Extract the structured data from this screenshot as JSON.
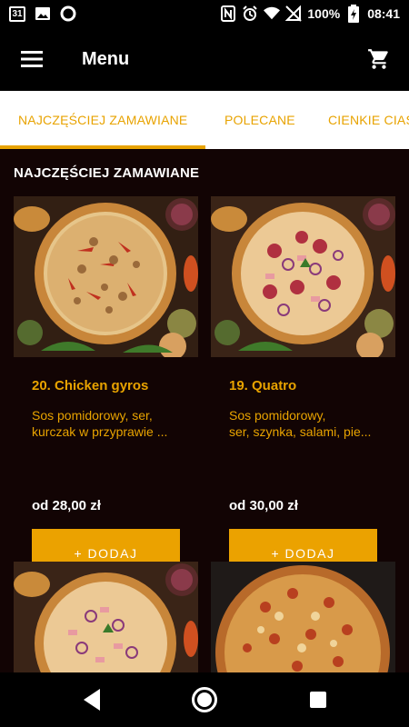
{
  "status_bar": {
    "calendar_day": "31",
    "battery": "100%",
    "time": "08:41",
    "icons": [
      "calendar-icon",
      "image-icon",
      "circle-icon",
      "nfc-icon",
      "alarm-icon",
      "wifi-icon",
      "no-sim-icon",
      "battery-icon"
    ]
  },
  "app_bar": {
    "title": "Menu",
    "menu_icon": "hamburger-menu-icon",
    "cart_icon": "shopping-cart-icon"
  },
  "tabs": [
    {
      "label": "NAJCZĘŚCIEJ ZAMAWIANE",
      "active": true
    },
    {
      "label": "POLECANE",
      "active": false
    },
    {
      "label": "CIENKIE CIAS",
      "active": false
    }
  ],
  "section": {
    "title": "NAJCZĘŚCIEJ ZAMAWIANE"
  },
  "products": [
    {
      "name": "20. Chicken gyros",
      "desc_line1": "Sos pomidorowy, ser,",
      "desc_line2": "kurczak w przyprawie ...",
      "price": "od 28,00 zł",
      "button": "+ DODAJ"
    },
    {
      "name": "19. Quatro",
      "desc_line1": "Sos pomidorowy,",
      "desc_line2": "ser, szynka, salami, pie...",
      "price": "od 30,00 zł",
      "button": "+ DODAJ"
    }
  ],
  "colors": {
    "accent": "#eba200",
    "content_bg": "#120404"
  }
}
